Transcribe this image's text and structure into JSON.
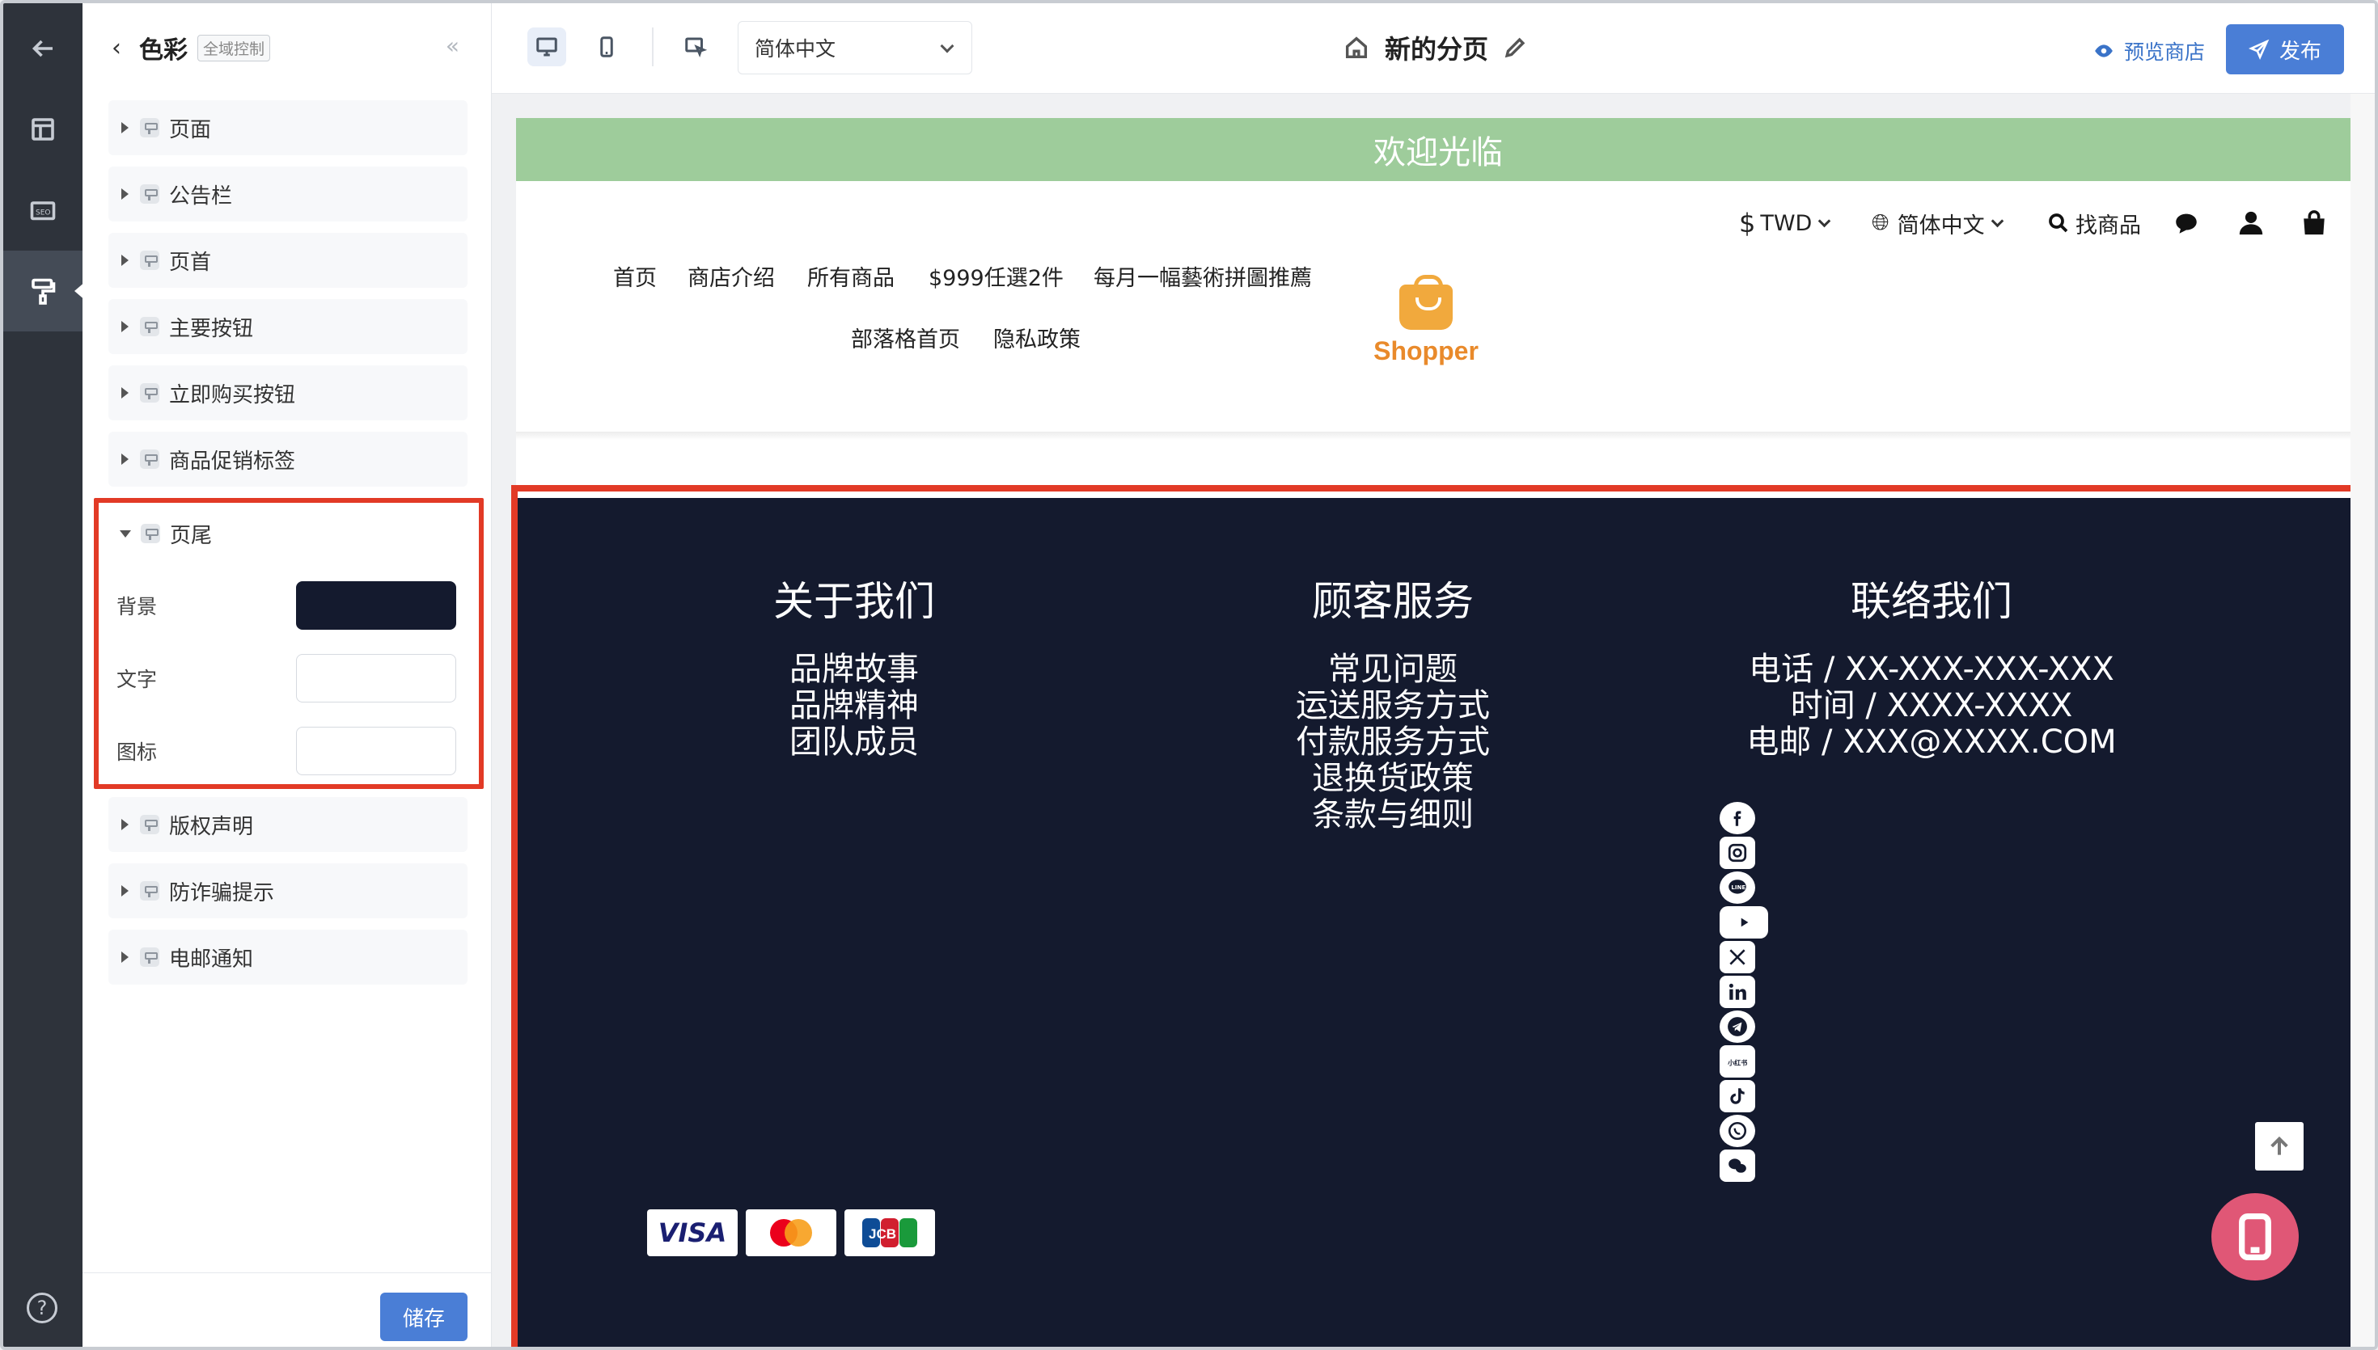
{
  "editor": {
    "panel_title": "色彩",
    "panel_badge": "全域控制",
    "collapse": "«",
    "sections": [
      "页面",
      "公告栏",
      "页首",
      "主要按钮",
      "立即购买按钮",
      "商品促销标签"
    ],
    "footer_section": {
      "label": "页尾",
      "rows": [
        {
          "label": "背景",
          "color": "#141a2e"
        },
        {
          "label": "文字",
          "color": "#ffffff"
        },
        {
          "label": "图标",
          "color": "#ffffff"
        }
      ]
    },
    "sections_after": [
      "版权声明",
      "防诈骗提示",
      "电邮通知"
    ],
    "save_label": "储存",
    "help": "?"
  },
  "toolbar": {
    "language": "简体中文",
    "page_name": "新的分页",
    "preview_label": "预览商店",
    "publish_label": "发布"
  },
  "site": {
    "announcement": "欢迎光临",
    "currency": "TWD",
    "currency_symbol": "$",
    "language": "简体中文",
    "search_label": "找商品",
    "nav_row1": [
      "首页",
      "商店介绍",
      "所有商品",
      "$999任選2件",
      "每月一幅藝術拼圖推薦"
    ],
    "nav_row2": [
      "部落格首页",
      "隐私政策"
    ],
    "logo_text": "Shopper",
    "footer": {
      "columns": [
        {
          "heading": "关于我们",
          "lines": [
            "品牌故事",
            "品牌精神",
            "团队成员"
          ]
        },
        {
          "heading": "顾客服务",
          "lines": [
            "常见问题",
            "运送服务方式",
            "付款服务方式",
            "退换货政策",
            "条款与细则"
          ]
        },
        {
          "heading": "联络我们",
          "lines": [
            "电话 / XX-XXX-XXX-XXX",
            "时间 / XXXX-XXXX",
            "电邮 / XXX@XXXX.COM"
          ]
        }
      ],
      "social_icons": [
        "facebook-icon",
        "instagram-icon",
        "line-icon",
        "youtube-icon",
        "x-icon",
        "linkedin-icon",
        "telegram-icon",
        "xiaohongshu-icon",
        "tiktok-icon",
        "whatsapp-icon",
        "wechat-icon"
      ],
      "xiaohongshu_text": "小红书",
      "payment_cards": [
        "VISA",
        "Mastercard",
        "JCB"
      ]
    }
  },
  "colors": {
    "accent": "#4a7ed6",
    "highlight": "#e23a26",
    "announcement_bg": "#9ecc9b",
    "footer_bg": "#141a2e",
    "fab": "#e05776"
  }
}
